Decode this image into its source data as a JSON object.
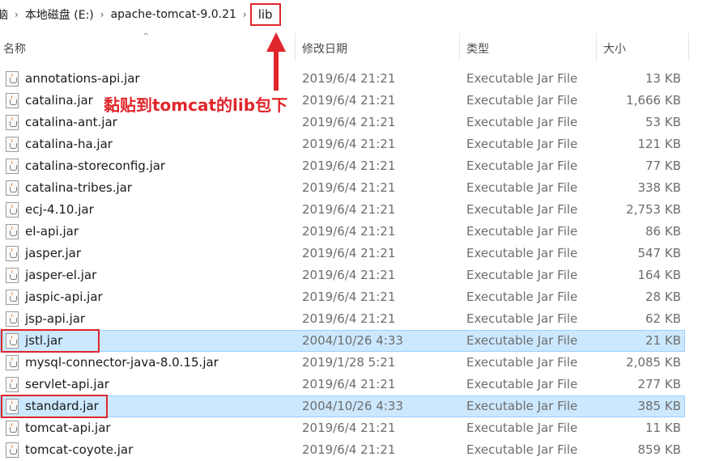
{
  "breadcrumb": {
    "items": [
      "脑",
      "本地磁盘 (E:)",
      "apache-tomcat-9.0.21",
      "lib"
    ],
    "separator": "›"
  },
  "columns": {
    "name": "名称",
    "date": "修改日期",
    "type": "类型",
    "size": "大小",
    "sort_indicator": "^"
  },
  "files": [
    {
      "name": "annotations-api.jar",
      "date": "2019/6/4 21:21",
      "type": "Executable Jar File",
      "size": "13 KB",
      "selected": false
    },
    {
      "name": "catalina.jar",
      "date": "2019/6/4 21:21",
      "type": "Executable Jar File",
      "size": "1,666 KB",
      "selected": false
    },
    {
      "name": "catalina-ant.jar",
      "date": "2019/6/4 21:21",
      "type": "Executable Jar File",
      "size": "53 KB",
      "selected": false
    },
    {
      "name": "catalina-ha.jar",
      "date": "2019/6/4 21:21",
      "type": "Executable Jar File",
      "size": "121 KB",
      "selected": false
    },
    {
      "name": "catalina-storeconfig.jar",
      "date": "2019/6/4 21:21",
      "type": "Executable Jar File",
      "size": "77 KB",
      "selected": false
    },
    {
      "name": "catalina-tribes.jar",
      "date": "2019/6/4 21:21",
      "type": "Executable Jar File",
      "size": "338 KB",
      "selected": false
    },
    {
      "name": "ecj-4.10.jar",
      "date": "2019/6/4 21:21",
      "type": "Executable Jar File",
      "size": "2,753 KB",
      "selected": false
    },
    {
      "name": "el-api.jar",
      "date": "2019/6/4 21:21",
      "type": "Executable Jar File",
      "size": "86 KB",
      "selected": false
    },
    {
      "name": "jasper.jar",
      "date": "2019/6/4 21:21",
      "type": "Executable Jar File",
      "size": "547 KB",
      "selected": false
    },
    {
      "name": "jasper-el.jar",
      "date": "2019/6/4 21:21",
      "type": "Executable Jar File",
      "size": "164 KB",
      "selected": false
    },
    {
      "name": "jaspic-api.jar",
      "date": "2019/6/4 21:21",
      "type": "Executable Jar File",
      "size": "28 KB",
      "selected": false
    },
    {
      "name": "jsp-api.jar",
      "date": "2019/6/4 21:21",
      "type": "Executable Jar File",
      "size": "62 KB",
      "selected": false
    },
    {
      "name": "jstl.jar",
      "date": "2004/10/26 4:33",
      "type": "Executable Jar File",
      "size": "21 KB",
      "selected": true
    },
    {
      "name": "mysql-connector-java-8.0.15.jar",
      "date": "2019/1/28 5:21",
      "type": "Executable Jar File",
      "size": "2,085 KB",
      "selected": false
    },
    {
      "name": "servlet-api.jar",
      "date": "2019/6/4 21:21",
      "type": "Executable Jar File",
      "size": "277 KB",
      "selected": false
    },
    {
      "name": "standard.jar",
      "date": "2004/10/26 4:33",
      "type": "Executable Jar File",
      "size": "385 KB",
      "selected": true
    },
    {
      "name": "tomcat-api.jar",
      "date": "2019/6/4 21:21",
      "type": "Executable Jar File",
      "size": "11 KB",
      "selected": false
    },
    {
      "name": "tomcat-coyote.jar",
      "date": "2019/6/4 21:21",
      "type": "Executable Jar File",
      "size": "859 KB",
      "selected": false
    }
  ],
  "annotation": {
    "text": "黏贴到tomcat的lib包下",
    "color": "#e0262b"
  },
  "colors": {
    "selection_bg": "#cce8ff",
    "selection_border": "#99d1ff",
    "highlight": "#e0262b"
  }
}
